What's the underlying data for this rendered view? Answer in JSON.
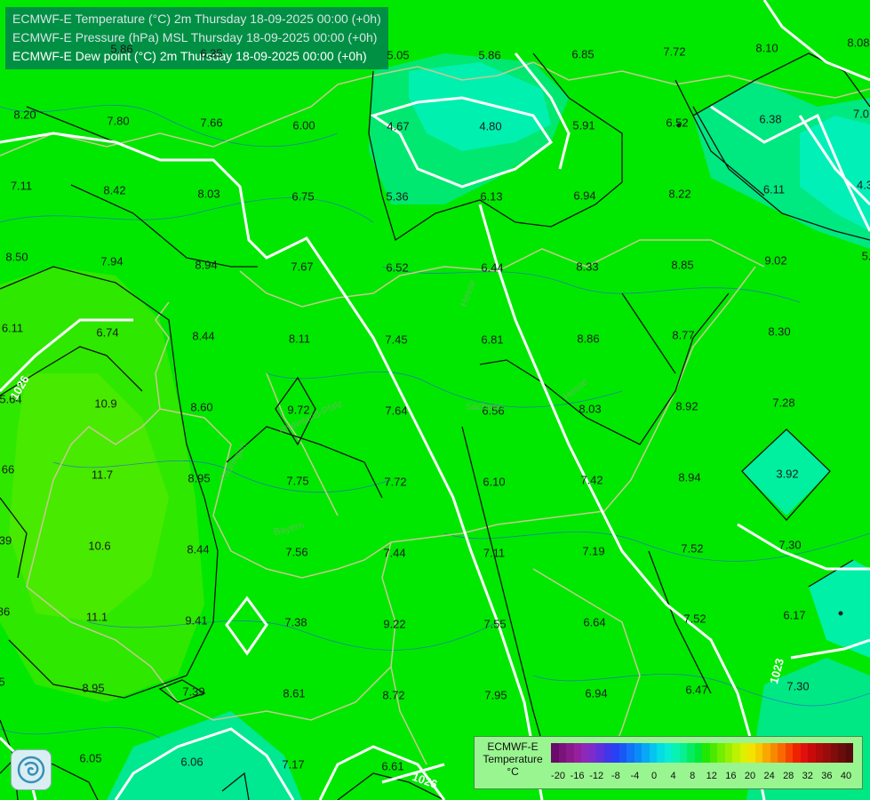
{
  "titles": {
    "temperature": "ECMWF-E Temperature (°C) 2m Thursday 18-09-2025 00:00 (+0h)",
    "pressure": "ECMWF-E Pressure (hPa) MSL Thursday 18-09-2025 00:00 (+0h)",
    "dewpoint": "ECMWF-E Dew point (°C) 2m Thursday 18-09-2025 00:00 (+0h)"
  },
  "map_values": [
    "5.05",
    "5.86",
    "6.85",
    "7.72",
    "8.10",
    "8.08",
    "8.20",
    "7.80",
    "7.66",
    "6.00",
    "4.67",
    "4.80",
    "5.91",
    "6.52",
    "6.38",
    "7.0",
    "7.11",
    "8.42",
    "8.03",
    "6.75",
    "5.36",
    "6.13",
    "6.94",
    "8.22",
    "6.11",
    "4.3",
    "8.50",
    "7.94",
    "8.94",
    "7.67",
    "6.52",
    "6.44",
    "8.33",
    "8.85",
    "9.02",
    "5.",
    "6.11",
    "6.74",
    "8.44",
    "8.11",
    "7.45",
    "6.81",
    "8.86",
    "8.77",
    "8.30",
    "5.64",
    "10.9",
    "8.60",
    "9.72",
    "7.64",
    "6.56",
    "8.03",
    "8.92",
    "7.28",
    "66",
    "11.7",
    "8.95",
    "7.75",
    "7.72",
    "6.10",
    "7.42",
    "8.94",
    "3.92",
    "39",
    "10.6",
    "8.44",
    "7.56",
    "7.44",
    "7.11",
    "7.19",
    "7.52",
    "7.30",
    "86",
    "11.1",
    "9.41",
    "7.38",
    "9.22",
    "7.55",
    "6.64",
    "7.52",
    "6.17",
    "5",
    "8.95",
    "7.39",
    "8.61",
    "8.72",
    "7.95",
    "6.94",
    "6.47",
    "7.30",
    "6.05",
    "6.06",
    "7.17",
    "6.61",
    "5.86",
    "6.35"
  ],
  "isobar_labels": [
    "1026",
    "1023",
    "1026"
  ],
  "map_place_labels": [
    "Hesse",
    "Hesse",
    "Rheinland-Pfalz",
    "Thüringen",
    "Sachsen",
    "Bayern"
  ],
  "legend": {
    "title_lines": [
      "ECMWF-E",
      "Temperature",
      "°C"
    ],
    "tick_labels": [
      "-20",
      "-16",
      "-12",
      "-8",
      "-4",
      "0",
      "4",
      "8",
      "12",
      "16",
      "20",
      "24",
      "28",
      "32",
      "36",
      "40"
    ],
    "colors": [
      "#6a0a6a",
      "#7a137a",
      "#8a1a8a",
      "#9420a0",
      "#8e28b8",
      "#7a2ccc",
      "#6030dc",
      "#4036ea",
      "#2a40f4",
      "#1a58f6",
      "#1272f8",
      "#0a8cf8",
      "#08a8f6",
      "#06c4f0",
      "#04dce6",
      "#08ecd4",
      "#08f2b4",
      "#08f090",
      "#04ec60",
      "#00e838",
      "#20e800",
      "#48ea00",
      "#72ee00",
      "#98f000",
      "#bcf200",
      "#dcf000",
      "#f2e400",
      "#f8c800",
      "#f8a800",
      "#f88800",
      "#f86a00",
      "#f64400",
      "#ee2200",
      "#e01010",
      "#c80a0a",
      "#b00a0a",
      "#980c0c",
      "#800c0c",
      "#6a0c0c",
      "#560a0a"
    ]
  }
}
